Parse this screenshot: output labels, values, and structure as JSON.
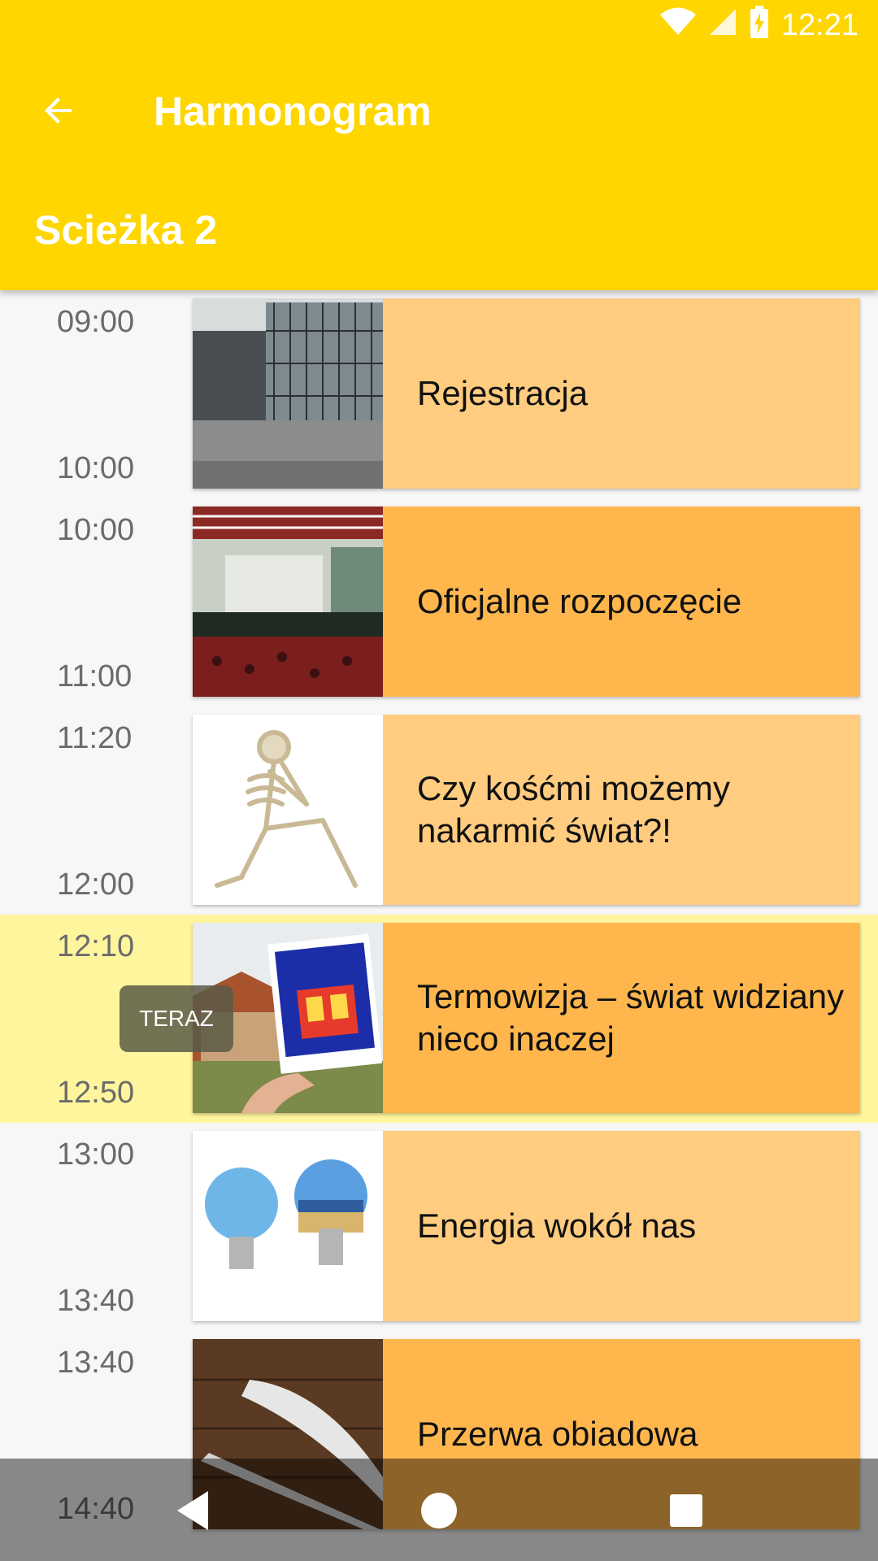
{
  "status_bar": {
    "time": "12:21",
    "icons": [
      "wifi-icon",
      "signal-icon",
      "battery-charging-icon"
    ]
  },
  "toolbar": {
    "back_icon": "arrow-back-icon",
    "title": "Harmonogram"
  },
  "track": {
    "title": "Scieżka 2"
  },
  "now_badge": "TERAZ",
  "schedule": [
    {
      "start": "09:00",
      "end": "10:00",
      "title": "Rejestracja",
      "image": "building-photo"
    },
    {
      "start": "10:00",
      "end": "11:00",
      "title": "Oficjalne rozpoczęcie",
      "image": "auditorium-photo"
    },
    {
      "start": "11:20",
      "end": "12:00",
      "title": "Czy kośćmi możemy nakarmić świat?!",
      "image": "skeleton-photo"
    },
    {
      "start": "12:10",
      "end": "12:50",
      "title": "Termowizja – świat widziany nieco inaczej",
      "image": "thermal-camera-photo",
      "current": true
    },
    {
      "start": "13:00",
      "end": "13:40",
      "title": "Energia wokół nas",
      "image": "lightbulbs-photo"
    },
    {
      "start": "13:40",
      "end": "14:40",
      "title": "Przerwa obiadowa",
      "image": "fork-knife-photo"
    }
  ],
  "colors": {
    "accent": "#ffd600",
    "card_light": "#ffcc80",
    "card_dark": "#ffb74d",
    "current_row": "#fff59d"
  },
  "nav_bar": [
    "back-nav-icon",
    "home-nav-icon",
    "recents-nav-icon"
  ]
}
